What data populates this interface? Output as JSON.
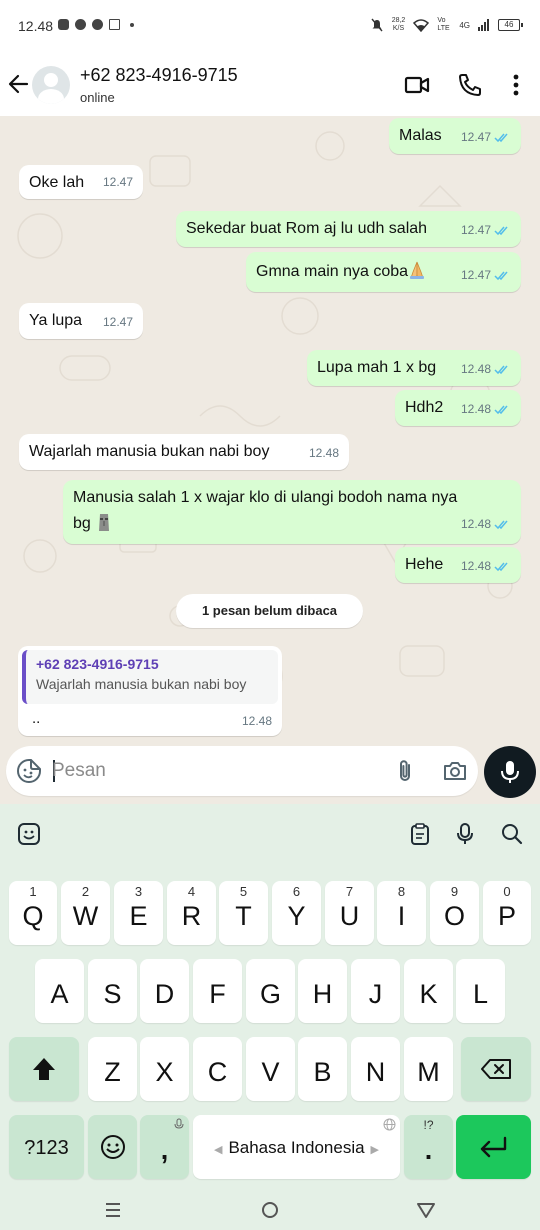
{
  "status_bar": {
    "time": "12.48",
    "net_speed": "28,2",
    "net_unit": "K/S",
    "volte": "Vo LTE",
    "network": "4G",
    "battery": "46"
  },
  "header": {
    "contact_name": "+62 823-4916-9715",
    "contact_status": "online"
  },
  "messages": [
    {
      "dir": "out",
      "text": "Malas",
      "time": "12.47"
    },
    {
      "dir": "in",
      "text": "Oke lah",
      "time": "12.47"
    },
    {
      "dir": "out",
      "text": "Sekedar buat Rom aj lu udh salah",
      "time": "12.47"
    },
    {
      "dir": "out",
      "text": "Gmna main nya coba",
      "time": "12.47"
    },
    {
      "dir": "in",
      "text": "Ya lupa",
      "time": "12.47"
    },
    {
      "dir": "out",
      "text": "Lupa mah 1 x bg",
      "time": "12.48"
    },
    {
      "dir": "out",
      "text": "Hdh2",
      "time": "12.48"
    },
    {
      "dir": "in",
      "text": "Wajarlah manusia bukan nabi boy",
      "time": "12.48"
    },
    {
      "dir": "out",
      "text_line1": "Manusia salah 1 x wajar klo di ulangi bodoh nama nya",
      "text_line2": "bg",
      "time": "12.48"
    },
    {
      "dir": "out",
      "text": "Hehe",
      "time": "12.48"
    }
  ],
  "unread_divider": "1 pesan belum dibaca",
  "reply_message": {
    "quoted_sender": "+62 823-4916-9715",
    "quoted_text": "Wajarlah manusia bukan nabi boy",
    "body": "..",
    "time": "12.48"
  },
  "composer": {
    "placeholder": "Pesan"
  },
  "keyboard": {
    "row1": [
      {
        "num": "1",
        "key": "Q"
      },
      {
        "num": "2",
        "key": "W"
      },
      {
        "num": "3",
        "key": "E"
      },
      {
        "num": "4",
        "key": "R"
      },
      {
        "num": "5",
        "key": "T"
      },
      {
        "num": "6",
        "key": "Y"
      },
      {
        "num": "7",
        "key": "U"
      },
      {
        "num": "8",
        "key": "I"
      },
      {
        "num": "9",
        "key": "O"
      },
      {
        "num": "0",
        "key": "P"
      }
    ],
    "row2": [
      "A",
      "S",
      "D",
      "F",
      "G",
      "H",
      "J",
      "K",
      "L"
    ],
    "row3": [
      "Z",
      "X",
      "C",
      "V",
      "B",
      "N",
      "M"
    ],
    "symbols_key": "?123",
    "comma_key": ",",
    "space_label": "Bahasa Indonesia",
    "period_key": ".",
    "period_hint": "!?"
  },
  "colors": {
    "outgoing_bubble": "#d9fdd3",
    "incoming_bubble": "#ffffff",
    "chat_background": "#efeae2",
    "read_tick": "#53bdeb",
    "quote_accent": "#6b4fc8",
    "enter_key": "#1cc85c",
    "keyboard_bg": "#e4f0e6"
  }
}
